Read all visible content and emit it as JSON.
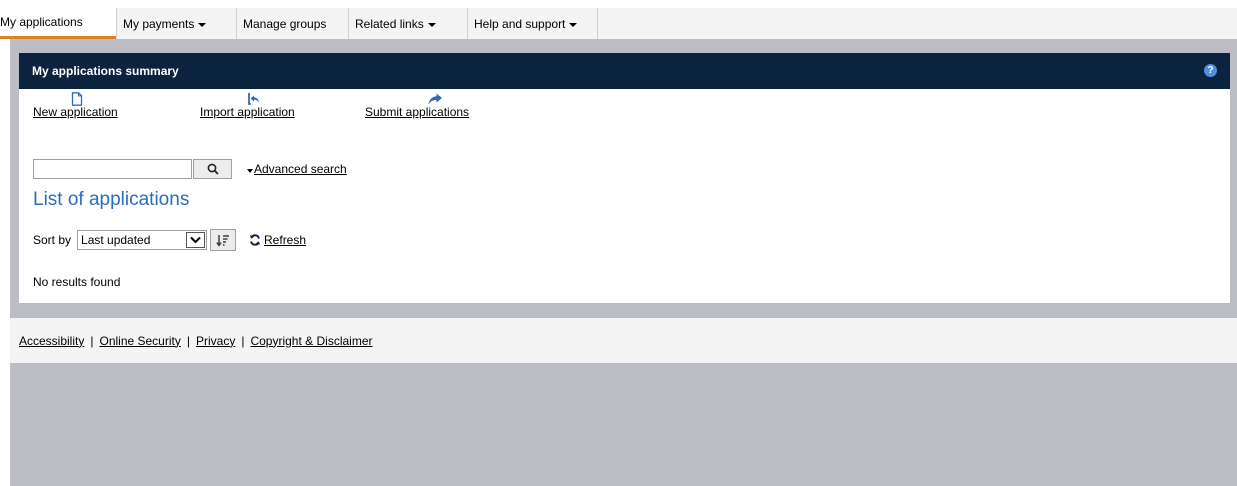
{
  "tabs": [
    {
      "label": "My applications",
      "active": true,
      "dropdown": false
    },
    {
      "label": "My payments",
      "active": false,
      "dropdown": true
    },
    {
      "label": "Manage groups",
      "active": false,
      "dropdown": false
    },
    {
      "label": "Related links",
      "active": false,
      "dropdown": true
    },
    {
      "label": "Help and support",
      "active": false,
      "dropdown": true
    }
  ],
  "panel": {
    "title": "My applications summary",
    "help_icon": "?"
  },
  "actions": {
    "new_label": "New application",
    "import_label": "Import application",
    "submit_label": "Submit applications"
  },
  "search": {
    "value": "",
    "placeholder": "",
    "advanced_label": "Advanced search"
  },
  "list": {
    "title": "List of applications",
    "sort_label": "Sort by",
    "sort_value": "Last updated",
    "refresh_label": "Refresh",
    "empty_message": "No results found"
  },
  "footer": {
    "links": [
      "Accessibility",
      "Online Security",
      "Privacy",
      "Copyright & Disclaimer"
    ],
    "separator": "|"
  },
  "colors": {
    "header_bg": "#0c2340",
    "title_blue": "#2a6ebb",
    "active_tab_underline": "#e0812a",
    "icon_blue": "#2a6ebb",
    "background_grey": "#bcbcc4"
  },
  "icons": {
    "new": "document-icon",
    "import": "import-arrow-icon",
    "submit": "share-arrow-icon",
    "search": "search-icon",
    "sort_order": "sort-descending-icon",
    "refresh": "refresh-icon"
  }
}
